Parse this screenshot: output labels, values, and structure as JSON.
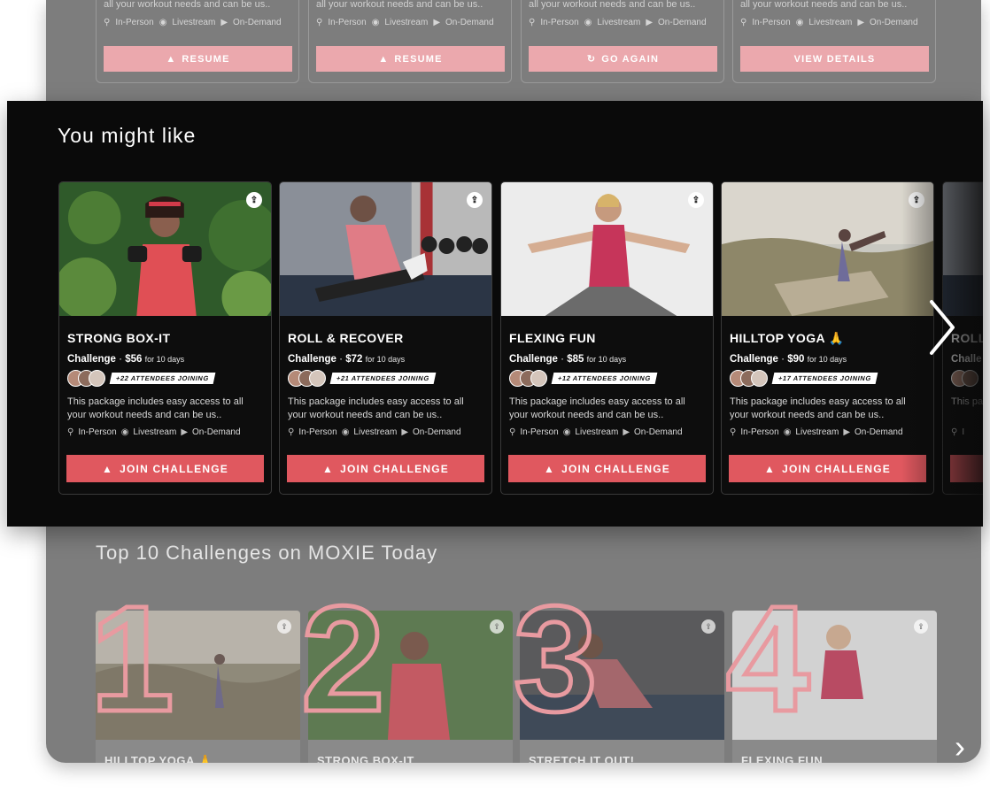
{
  "background": {
    "top_cards": [
      {
        "desc": "all your workout needs and can be us..",
        "meta": [
          "In-Person",
          "Livestream",
          "On-Demand"
        ],
        "button": "RESUME",
        "button_icon": "mountain-icon"
      },
      {
        "desc": "all your workout needs and can be us..",
        "meta": [
          "In-Person",
          "Livestream",
          "On-Demand"
        ],
        "button": "RESUME",
        "button_icon": "mountain-icon"
      },
      {
        "desc": "all your workout needs and can be us..",
        "meta": [
          "In-Person",
          "Livestream",
          "On-Demand"
        ],
        "button": "GO AGAIN",
        "button_icon": "refresh-icon"
      },
      {
        "desc": "all your workout needs and can be us..",
        "meta": [
          "In-Person",
          "Livestream",
          "On-Demand"
        ],
        "button": "VIEW DETAILS",
        "button_icon": ""
      }
    ],
    "top10_title": "Top 10 Challenges on MOXIE Today",
    "top10": [
      {
        "rank": "1",
        "name": "HILLTOP YOGA 🙏"
      },
      {
        "rank": "2",
        "name": "STRONG BOX-IT"
      },
      {
        "rank": "3",
        "name": "STRETCH IT OUT!"
      },
      {
        "rank": "4",
        "name": "FLEXING FUN"
      }
    ]
  },
  "panel": {
    "title": "You might like",
    "cards": [
      {
        "title": "STRONG BOX-IT",
        "type": "Challenge",
        "price": "$56",
        "duration": "for 10 days",
        "attendees": "+22 ATTENDEES JOINING",
        "desc": "This package includes easy access to all your workout needs and can be us..",
        "meta": [
          "In-Person",
          "Livestream",
          "On-Demand"
        ],
        "button": "JOIN CHALLENGE"
      },
      {
        "title": "ROLL & RECOVER",
        "type": "Challenge",
        "price": "$72",
        "duration": "for 10 days",
        "attendees": "+21 ATTENDEES JOINING",
        "desc": "This package includes easy access to all your workout needs and can be us..",
        "meta": [
          "In-Person",
          "Livestream",
          "On-Demand"
        ],
        "button": "JOIN CHALLENGE"
      },
      {
        "title": "FLEXING FUN",
        "type": "Challenge",
        "price": "$85",
        "duration": "for 10 days",
        "attendees": "+12 ATTENDEES JOINING",
        "desc": "This package includes easy access to all your workout needs and can be us..",
        "meta": [
          "In-Person",
          "Livestream",
          "On-Demand"
        ],
        "button": "JOIN CHALLENGE"
      },
      {
        "title": "HILLTOP YOGA 🙏",
        "type": "Challenge",
        "price": "$90",
        "duration": "for 10 days",
        "attendees": "+17 ATTENDEES JOINING",
        "desc": "This package includes easy access to all your workout needs and can be us..",
        "meta": [
          "In-Person",
          "Livestream",
          "On-Demand"
        ],
        "button": "JOIN CHALLENGE"
      },
      {
        "title": "ROLL",
        "type": "Challe",
        "price": "",
        "duration": "",
        "attendees": "",
        "desc": "This pa all you",
        "meta": [
          "I"
        ],
        "button": ""
      }
    ]
  },
  "colors": {
    "accent": "#e0585f",
    "accent_light": "#eba8ad",
    "panel_bg": "#0a0a0a",
    "dim_bg": "#7d7d7d"
  }
}
